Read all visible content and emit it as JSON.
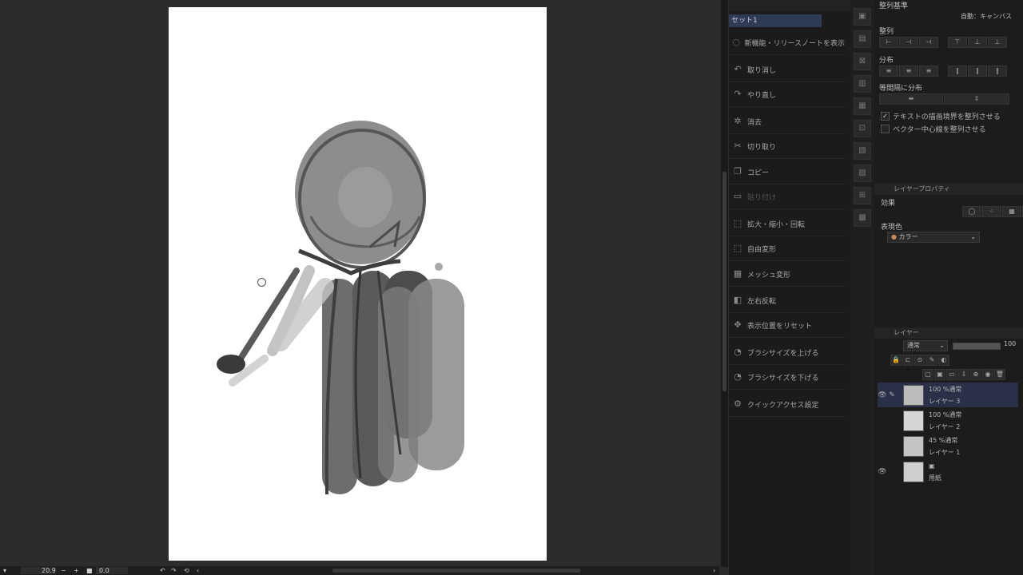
{
  "status_bar": {
    "zoom": "20.9",
    "angle": "0.0"
  },
  "quick_access": {
    "set_name": "セット1",
    "items": [
      {
        "label": "新機能・リリースノートを表示",
        "icon": "info-icon",
        "enabled": true
      },
      {
        "label": "取り消し",
        "icon": "undo-icon",
        "enabled": true
      },
      {
        "label": "やり直し",
        "icon": "redo-icon",
        "enabled": true
      },
      {
        "label": "消去",
        "icon": "clear-icon",
        "enabled": true
      },
      {
        "label": "切り取り",
        "icon": "cut-icon",
        "enabled": true
      },
      {
        "label": "コピー",
        "icon": "copy-icon",
        "enabled": true
      },
      {
        "label": "貼り付け",
        "icon": "paste-icon",
        "enabled": false
      },
      {
        "label": "拡大・縮小・回転",
        "icon": "transform-icon",
        "enabled": true
      },
      {
        "label": "自由変形",
        "icon": "free-transform-icon",
        "enabled": true
      },
      {
        "label": "メッシュ変形",
        "icon": "mesh-icon",
        "enabled": true
      },
      {
        "label": "左右反転",
        "icon": "flip-icon",
        "enabled": true
      },
      {
        "label": "表示位置をリセット",
        "icon": "reset-view-icon",
        "enabled": true
      },
      {
        "label": "ブラシサイズを上げる",
        "icon": "brush-up-icon",
        "enabled": true
      },
      {
        "label": "ブラシサイズを下げる",
        "icon": "brush-down-icon",
        "enabled": true
      },
      {
        "label": "クイックアクセス設定",
        "icon": "settings-icon",
        "enabled": true
      }
    ]
  },
  "align_panel": {
    "basis_label": "整列基準",
    "basis_value": "自動：キャンバス",
    "align_label": "整列",
    "distribute_label": "分布",
    "equal_spacing_label": "等間隔に分布",
    "check_text_bounds": "テキストの描画境界を整列させる",
    "check_text_bounds_checked": true,
    "check_vector_center": "ベクター中心線を整列させる",
    "check_vector_center_checked": false
  },
  "layer_property": {
    "tab_label": "レイヤープロパティ",
    "effect_label": "効果",
    "expression_color_label": "表現色",
    "expression_color_value": "カラー"
  },
  "layer_panel": {
    "tab_label": "レイヤー",
    "blend_mode": "通常",
    "opacity": "100",
    "layers": [
      {
        "opacity_mode": "100 %通常",
        "name": "レイヤー 3",
        "visible": true,
        "selected": true
      },
      {
        "opacity_mode": "100 %通常",
        "name": "レイヤー 2",
        "visible": false,
        "selected": false
      },
      {
        "opacity_mode": "45 %通常",
        "name": "レイヤー 1",
        "visible": false,
        "selected": false
      },
      {
        "opacity_mode": "",
        "name": "用紙",
        "visible": true,
        "selected": false
      }
    ]
  }
}
